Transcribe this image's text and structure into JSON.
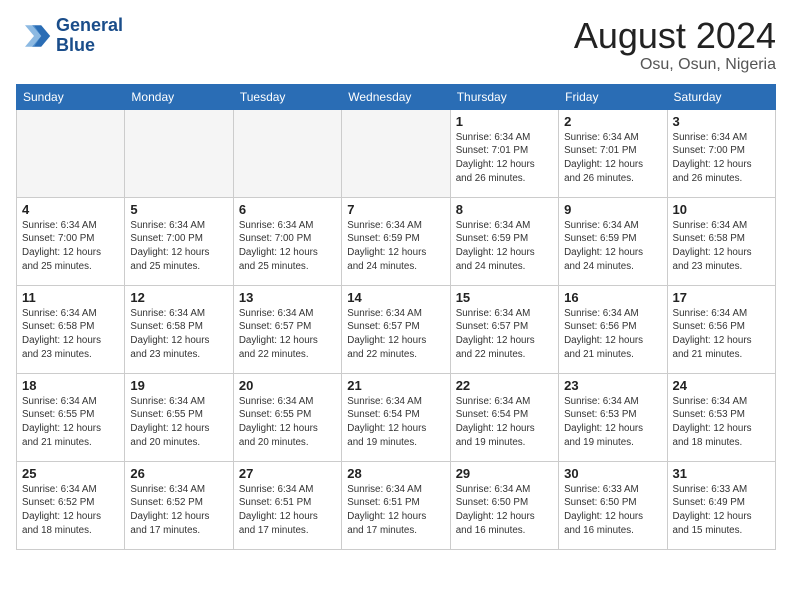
{
  "header": {
    "logo_line1": "General",
    "logo_line2": "Blue",
    "month": "August 2024",
    "location": "Osu, Osun, Nigeria"
  },
  "days_of_week": [
    "Sunday",
    "Monday",
    "Tuesday",
    "Wednesday",
    "Thursday",
    "Friday",
    "Saturday"
  ],
  "weeks": [
    [
      {
        "day": "",
        "info": ""
      },
      {
        "day": "",
        "info": ""
      },
      {
        "day": "",
        "info": ""
      },
      {
        "day": "",
        "info": ""
      },
      {
        "day": "1",
        "info": "Sunrise: 6:34 AM\nSunset: 7:01 PM\nDaylight: 12 hours\nand 26 minutes."
      },
      {
        "day": "2",
        "info": "Sunrise: 6:34 AM\nSunset: 7:01 PM\nDaylight: 12 hours\nand 26 minutes."
      },
      {
        "day": "3",
        "info": "Sunrise: 6:34 AM\nSunset: 7:00 PM\nDaylight: 12 hours\nand 26 minutes."
      }
    ],
    [
      {
        "day": "4",
        "info": "Sunrise: 6:34 AM\nSunset: 7:00 PM\nDaylight: 12 hours\nand 25 minutes."
      },
      {
        "day": "5",
        "info": "Sunrise: 6:34 AM\nSunset: 7:00 PM\nDaylight: 12 hours\nand 25 minutes."
      },
      {
        "day": "6",
        "info": "Sunrise: 6:34 AM\nSunset: 7:00 PM\nDaylight: 12 hours\nand 25 minutes."
      },
      {
        "day": "7",
        "info": "Sunrise: 6:34 AM\nSunset: 6:59 PM\nDaylight: 12 hours\nand 24 minutes."
      },
      {
        "day": "8",
        "info": "Sunrise: 6:34 AM\nSunset: 6:59 PM\nDaylight: 12 hours\nand 24 minutes."
      },
      {
        "day": "9",
        "info": "Sunrise: 6:34 AM\nSunset: 6:59 PM\nDaylight: 12 hours\nand 24 minutes."
      },
      {
        "day": "10",
        "info": "Sunrise: 6:34 AM\nSunset: 6:58 PM\nDaylight: 12 hours\nand 23 minutes."
      }
    ],
    [
      {
        "day": "11",
        "info": "Sunrise: 6:34 AM\nSunset: 6:58 PM\nDaylight: 12 hours\nand 23 minutes."
      },
      {
        "day": "12",
        "info": "Sunrise: 6:34 AM\nSunset: 6:58 PM\nDaylight: 12 hours\nand 23 minutes."
      },
      {
        "day": "13",
        "info": "Sunrise: 6:34 AM\nSunset: 6:57 PM\nDaylight: 12 hours\nand 22 minutes."
      },
      {
        "day": "14",
        "info": "Sunrise: 6:34 AM\nSunset: 6:57 PM\nDaylight: 12 hours\nand 22 minutes."
      },
      {
        "day": "15",
        "info": "Sunrise: 6:34 AM\nSunset: 6:57 PM\nDaylight: 12 hours\nand 22 minutes."
      },
      {
        "day": "16",
        "info": "Sunrise: 6:34 AM\nSunset: 6:56 PM\nDaylight: 12 hours\nand 21 minutes."
      },
      {
        "day": "17",
        "info": "Sunrise: 6:34 AM\nSunset: 6:56 PM\nDaylight: 12 hours\nand 21 minutes."
      }
    ],
    [
      {
        "day": "18",
        "info": "Sunrise: 6:34 AM\nSunset: 6:55 PM\nDaylight: 12 hours\nand 21 minutes."
      },
      {
        "day": "19",
        "info": "Sunrise: 6:34 AM\nSunset: 6:55 PM\nDaylight: 12 hours\nand 20 minutes."
      },
      {
        "day": "20",
        "info": "Sunrise: 6:34 AM\nSunset: 6:55 PM\nDaylight: 12 hours\nand 20 minutes."
      },
      {
        "day": "21",
        "info": "Sunrise: 6:34 AM\nSunset: 6:54 PM\nDaylight: 12 hours\nand 19 minutes."
      },
      {
        "day": "22",
        "info": "Sunrise: 6:34 AM\nSunset: 6:54 PM\nDaylight: 12 hours\nand 19 minutes."
      },
      {
        "day": "23",
        "info": "Sunrise: 6:34 AM\nSunset: 6:53 PM\nDaylight: 12 hours\nand 19 minutes."
      },
      {
        "day": "24",
        "info": "Sunrise: 6:34 AM\nSunset: 6:53 PM\nDaylight: 12 hours\nand 18 minutes."
      }
    ],
    [
      {
        "day": "25",
        "info": "Sunrise: 6:34 AM\nSunset: 6:52 PM\nDaylight: 12 hours\nand 18 minutes."
      },
      {
        "day": "26",
        "info": "Sunrise: 6:34 AM\nSunset: 6:52 PM\nDaylight: 12 hours\nand 17 minutes."
      },
      {
        "day": "27",
        "info": "Sunrise: 6:34 AM\nSunset: 6:51 PM\nDaylight: 12 hours\nand 17 minutes."
      },
      {
        "day": "28",
        "info": "Sunrise: 6:34 AM\nSunset: 6:51 PM\nDaylight: 12 hours\nand 17 minutes."
      },
      {
        "day": "29",
        "info": "Sunrise: 6:34 AM\nSunset: 6:50 PM\nDaylight: 12 hours\nand 16 minutes."
      },
      {
        "day": "30",
        "info": "Sunrise: 6:33 AM\nSunset: 6:50 PM\nDaylight: 12 hours\nand 16 minutes."
      },
      {
        "day": "31",
        "info": "Sunrise: 6:33 AM\nSunset: 6:49 PM\nDaylight: 12 hours\nand 15 minutes."
      }
    ]
  ]
}
